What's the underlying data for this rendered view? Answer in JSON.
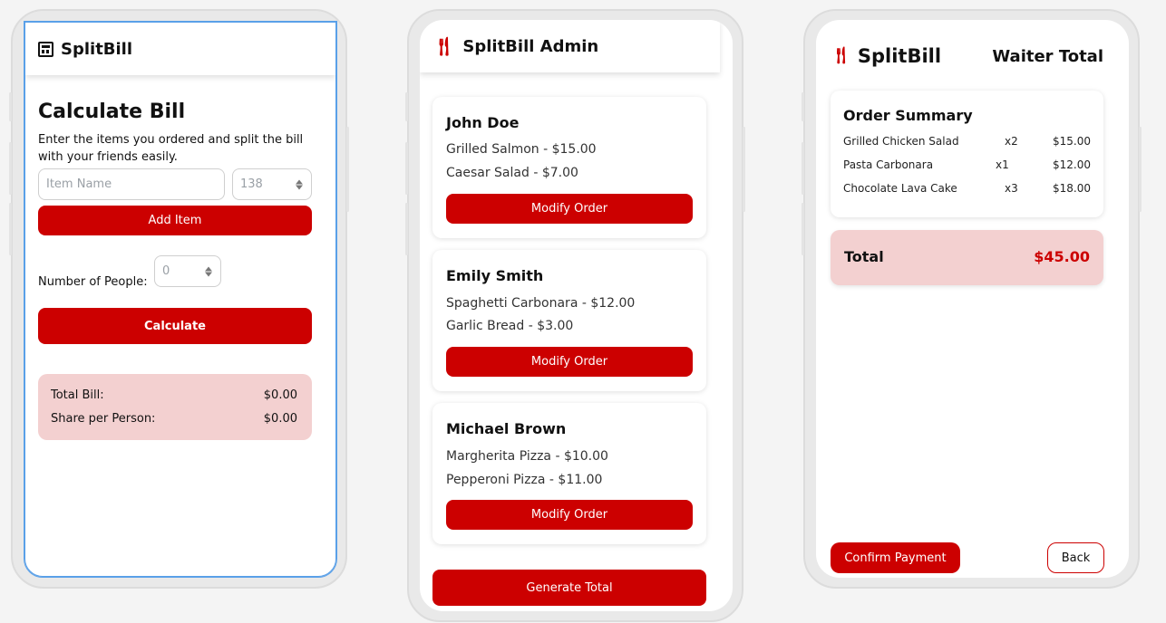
{
  "calc": {
    "app_title": "SplitBill",
    "heading": "Calculate Bill",
    "subtitle": "Enter the items you ordered and split the bill with your friends easily.",
    "item_name_placeholder": "Item Name",
    "item_price_value": "138",
    "add_item_label": "Add Item",
    "people_label": "Number of People:",
    "people_value": "0",
    "calculate_label": "Calculate",
    "total_bill_label": "Total Bill:",
    "total_bill_value": "$0.00",
    "share_label": "Share per Person:",
    "share_value": "$0.00"
  },
  "admin": {
    "app_title": "SplitBill Admin",
    "icon": "utensils-icon",
    "orders": [
      {
        "name": "John Doe",
        "items": [
          "Grilled Salmon - $15.00",
          "Caesar Salad - $7.00"
        ],
        "button": "Modify Order"
      },
      {
        "name": "Emily Smith",
        "items": [
          "Spaghetti Carbonara - $12.00",
          "Garlic Bread - $3.00"
        ],
        "button": "Modify Order"
      },
      {
        "name": "Michael Brown",
        "items": [
          "Margherita Pizza - $10.00",
          "Pepperoni Pizza - $11.00"
        ],
        "button": "Modify Order"
      }
    ],
    "generate_label": "Generate Total"
  },
  "waiter": {
    "app_title": "SplitBill",
    "page_title": "Waiter Total",
    "summary_title": "Order Summary",
    "rows": [
      {
        "name": "Grilled Chicken Salad",
        "qty": "x2",
        "price": "$15.00"
      },
      {
        "name": "Pasta Carbonara",
        "qty": "x1",
        "price": "$12.00"
      },
      {
        "name": "Chocolate Lava Cake",
        "qty": "x3",
        "price": "$18.00"
      }
    ],
    "total_label": "Total",
    "total_value": "$45.00",
    "confirm_label": "Confirm Payment",
    "back_label": "Back"
  },
  "colors": {
    "accent": "#cc0000",
    "pink": "#f3d0d0"
  }
}
